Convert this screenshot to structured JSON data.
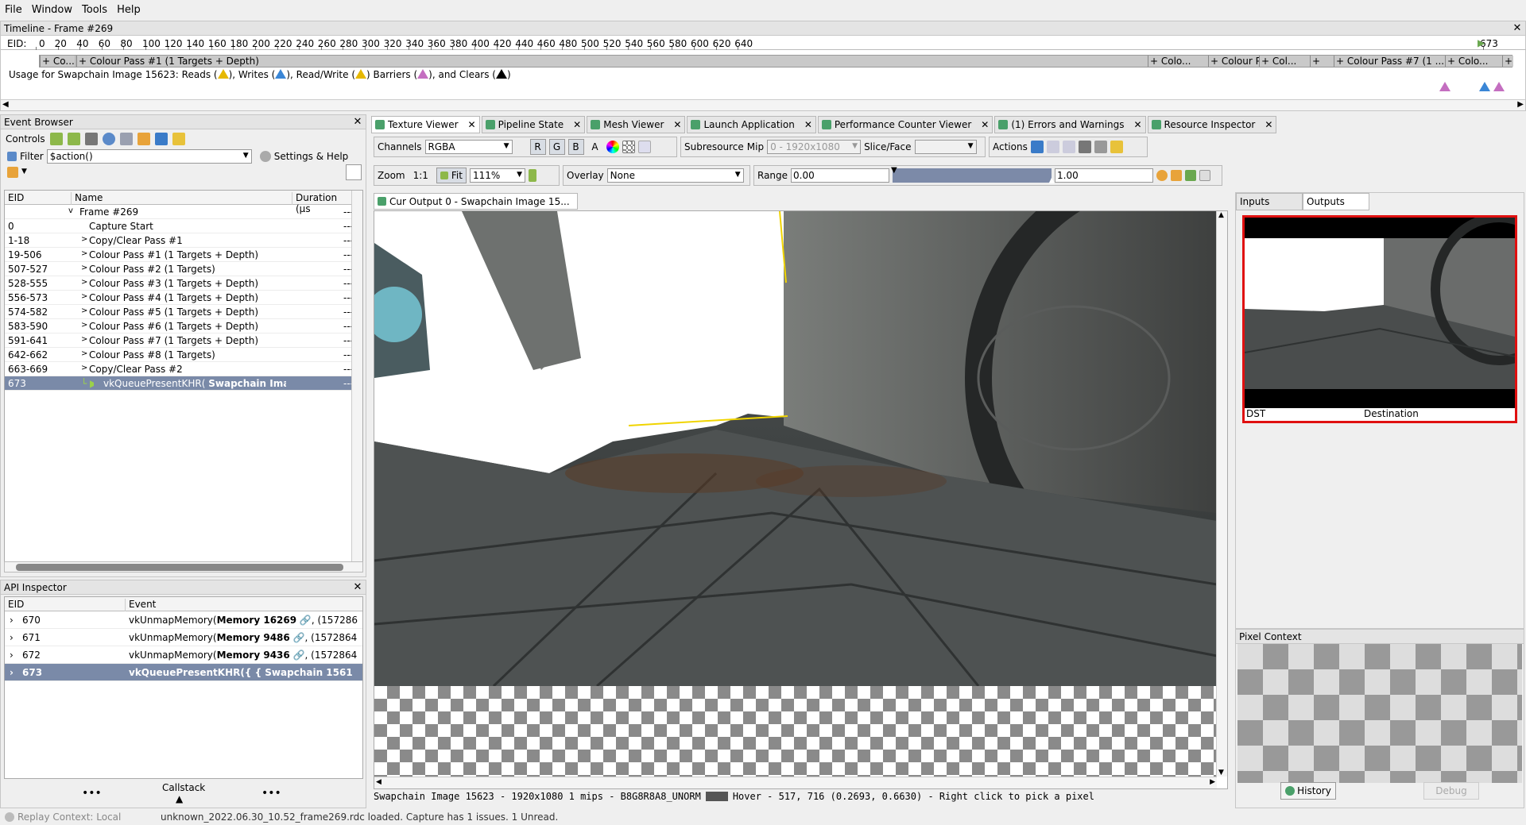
{
  "menu": [
    "File",
    "Window",
    "Tools",
    "Help"
  ],
  "timeline": {
    "title": "Timeline - Frame #269",
    "eid_label": "EID:",
    "ticks": [
      "0",
      "20",
      "40",
      "60",
      "80",
      "100",
      "120",
      "140",
      "160",
      "180",
      "200",
      "220",
      "240",
      "260",
      "280",
      "300",
      "320",
      "340",
      "360",
      "380",
      "400",
      "420",
      "440",
      "460",
      "480",
      "500",
      "520",
      "540",
      "560",
      "580",
      "600",
      "620",
      "640",
      "673"
    ],
    "passes": [
      "+ Co...",
      "+ Colour Pass #1 (1 Targets + Depth)",
      "+ Colo...",
      "+ Colour P...",
      "+ Col...",
      "+",
      "+ Colour Pass #7 (1 ...",
      "+ Colo...",
      "+"
    ],
    "usage_text": "Usage for Swapchain Image 15623:",
    "usage_reads": "Reads (",
    "usage_writes": "), Writes (",
    "usage_rw": "), Read/Write (",
    "usage_barriers": ") Barriers (",
    "usage_clears": "), and Clears (",
    "usage_end": ")"
  },
  "event_browser": {
    "title": "Event Browser",
    "controls_label": "Controls",
    "filter_label": "Filter",
    "filter_value": "$action()",
    "settings_label": "Settings & Help",
    "columns": [
      "EID",
      "Name",
      "Duration (µs"
    ],
    "rows": [
      {
        "eid": "",
        "name": "Frame #269",
        "dur": "---",
        "expander": "v"
      },
      {
        "eid": "0",
        "name": "Capture Start",
        "dur": "---",
        "expander": ""
      },
      {
        "eid": "1-18",
        "name": "Copy/Clear Pass #1",
        "dur": "---",
        "expander": ">"
      },
      {
        "eid": "19-506",
        "name": "Colour Pass #1 (1 Targets + Depth)",
        "dur": "---",
        "expander": ">"
      },
      {
        "eid": "507-527",
        "name": "Colour Pass #2 (1 Targets)",
        "dur": "---",
        "expander": ">"
      },
      {
        "eid": "528-555",
        "name": "Colour Pass #3 (1 Targets + Depth)",
        "dur": "---",
        "expander": ">"
      },
      {
        "eid": "556-573",
        "name": "Colour Pass #4 (1 Targets + Depth)",
        "dur": "---",
        "expander": ">"
      },
      {
        "eid": "574-582",
        "name": "Colour Pass #5 (1 Targets + Depth)",
        "dur": "---",
        "expander": ">"
      },
      {
        "eid": "583-590",
        "name": "Colour Pass #6 (1 Targets + Depth)",
        "dur": "---",
        "expander": ">"
      },
      {
        "eid": "591-641",
        "name": "Colour Pass #7 (1 Targets + Depth)",
        "dur": "---",
        "expander": ">"
      },
      {
        "eid": "642-662",
        "name": "Colour Pass #8 (1 Targets)",
        "dur": "---",
        "expander": ">"
      },
      {
        "eid": "663-669",
        "name": "Copy/Clear Pass #2",
        "dur": "---",
        "expander": ">"
      },
      {
        "eid": "673",
        "name": "vkQueuePresentKHR(",
        "name_bold": "Swapchain Ima",
        "dur": "---",
        "expander": "",
        "selected": true
      }
    ]
  },
  "api_inspector": {
    "title": "API Inspector",
    "columns": [
      "EID",
      "Event"
    ],
    "rows": [
      {
        "eid": "670",
        "fn": "vkUnmapMemory(",
        "obj": "Memory 16269",
        "rest": ", (157286"
      },
      {
        "eid": "671",
        "fn": "vkUnmapMemory(",
        "obj": "Memory 9486",
        "rest": ", (1572864"
      },
      {
        "eid": "672",
        "fn": "vkUnmapMemory(",
        "obj": "Memory 9436",
        "rest": ", (1572864"
      },
      {
        "eid": "673",
        "fn": "vkQueuePresentKHR({  {  Swapchain 1561",
        "obj": "",
        "rest": "",
        "selected": true
      }
    ],
    "callstack": "Callstack",
    "dots": "•••"
  },
  "tabs": [
    {
      "label": "Texture Viewer",
      "active": true
    },
    {
      "label": "Pipeline State"
    },
    {
      "label": "Mesh Viewer"
    },
    {
      "label": "Launch Application"
    },
    {
      "label": "Performance Counter Viewer"
    },
    {
      "label": "(1) Errors and Warnings"
    },
    {
      "label": "Resource Inspector"
    }
  ],
  "toolbar": {
    "channels_label": "Channels",
    "channels_value": "RGBA",
    "r": "R",
    "g": "G",
    "b": "B",
    "a": "A",
    "subresource": "Subresource",
    "mip_label": "Mip",
    "mip_value": "0 - 1920x1080",
    "slice_label": "Slice/Face",
    "actions": "Actions",
    "zoom_label": "Zoom",
    "zoom_11": "1:1",
    "fit": "Fit",
    "zoom_value": "111%",
    "overlay_label": "Overlay",
    "overlay_value": "None",
    "range_label": "Range",
    "range_min": "0.00",
    "range_max": "1.00"
  },
  "viewer": {
    "tab": "Cur Output 0 - Swapchain Image 15...",
    "status": "Swapchain Image 15623 - 1920x1080 1 mips - B8G8R8A8_UNORM",
    "hover": "Hover -    517,  716 (0.2693, 0.6630)  - Right click to pick a pixel"
  },
  "right": {
    "inputs": "Inputs",
    "outputs": "Outputs",
    "thumb_left": "DST",
    "thumb_right": "Destination",
    "pixel_context": "Pixel Context",
    "history": "History",
    "debug": "Debug"
  },
  "status_bar": {
    "replay": "Replay Context: Local",
    "message": "unknown_2022.06.30_10.52_frame269.rdc loaded. Capture has 1 issues. 1 Unread."
  }
}
